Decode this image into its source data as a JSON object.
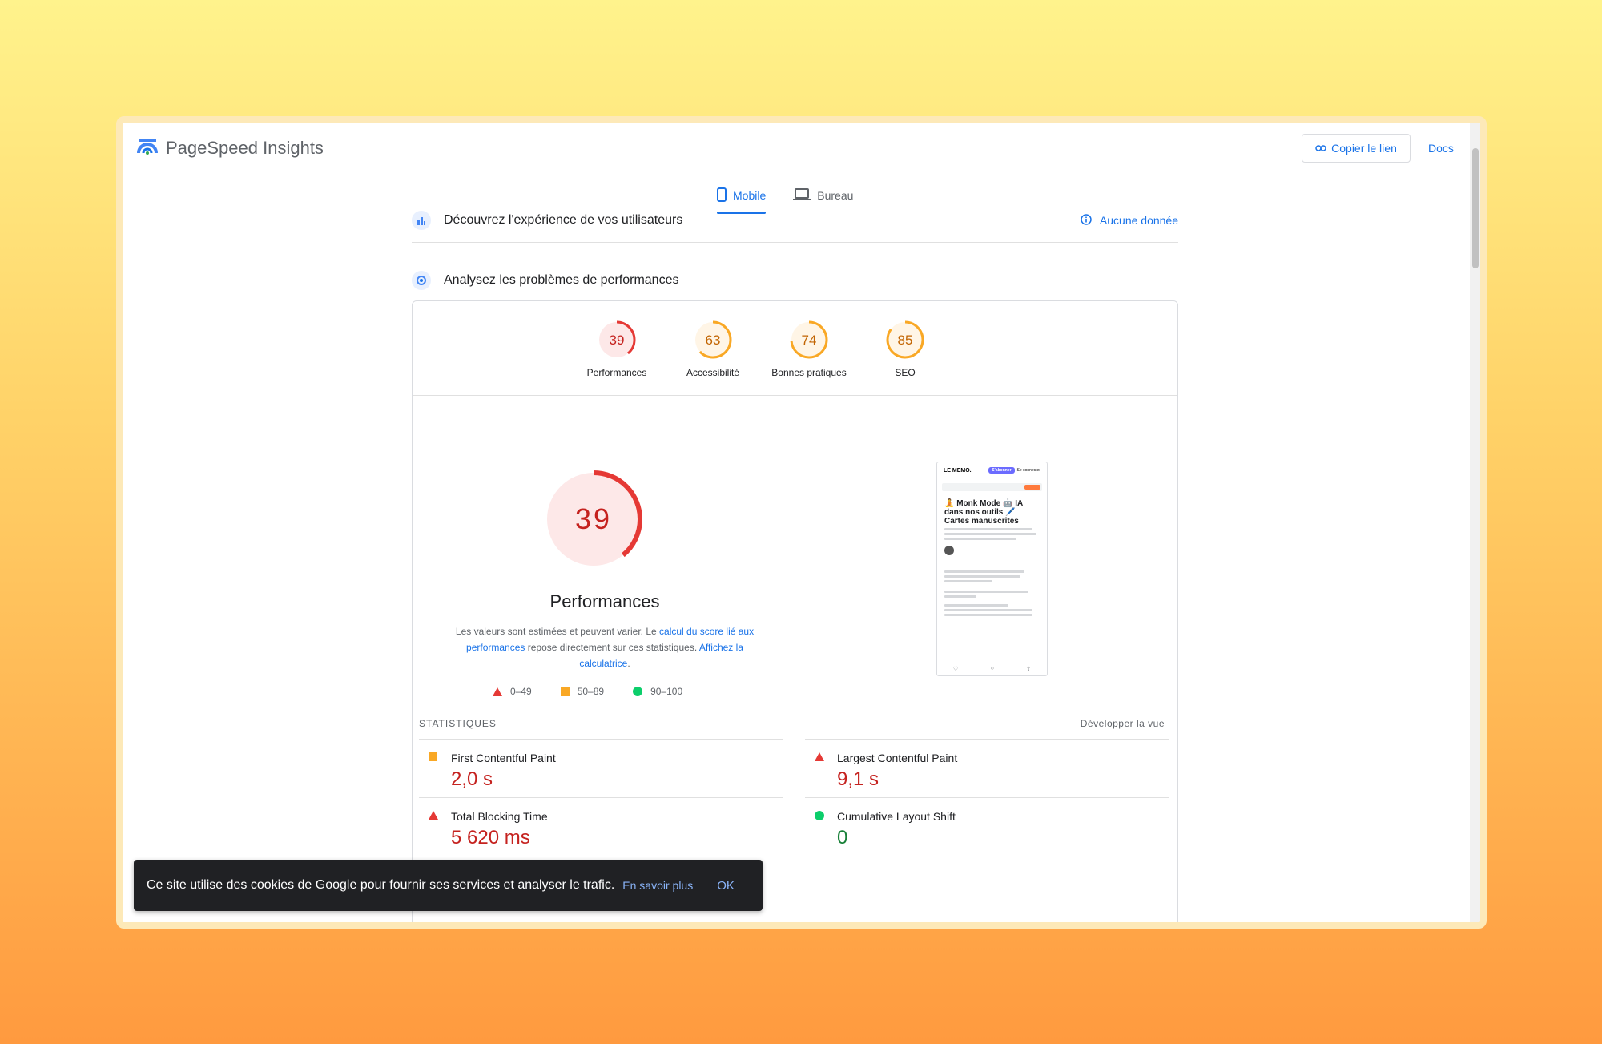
{
  "app": {
    "title": "PageSpeed Insights"
  },
  "header": {
    "copy_link_label": "Copier le lien",
    "docs_label": "Docs"
  },
  "tabs": [
    {
      "label": "Mobile",
      "active": true
    },
    {
      "label": "Bureau",
      "active": false
    }
  ],
  "field_section": {
    "title": "Découvrez l'expérience de vos utilisateurs",
    "status": "Aucune donnée"
  },
  "lab_section": {
    "title": "Analysez les problèmes de performances"
  },
  "scores": [
    {
      "label": "Performances",
      "value": 39,
      "color": "#e53935",
      "bg": "#fde8e8"
    },
    {
      "label": "Accessibilité",
      "value": 63,
      "color": "#f9a825",
      "bg": "#fff5e6"
    },
    {
      "label": "Bonnes pratiques",
      "value": 74,
      "color": "#f9a825",
      "bg": "#fff5e6"
    },
    {
      "label": "SEO",
      "value": 85,
      "color": "#f9a825",
      "bg": "#fff5e6"
    }
  ],
  "performance": {
    "score": "39",
    "title": "Performances",
    "desc_1": "Les valeurs sont estimées et peuvent varier. Le ",
    "desc_link_1": "calcul du score lié aux performances",
    "desc_2": " repose directement sur ces statistiques. ",
    "desc_link_2": "Affichez la calculatrice",
    "desc_3": "."
  },
  "legend": [
    {
      "range": "0–49",
      "shape": "triangle",
      "color": "#e53935"
    },
    {
      "range": "50–89",
      "shape": "square",
      "color": "#f9a825"
    },
    {
      "range": "90–100",
      "shape": "circle",
      "color": "#0cce6b"
    }
  ],
  "screenshot": {
    "brand": "LE MEMO.",
    "button": "S'abonner",
    "login": "Se connecter",
    "article_title": "🧘 Monk Mode 🤖 IA dans nos outils 🖊️ Cartes manuscrites"
  },
  "stats": {
    "label": "STATISTIQUES",
    "expand_label": "Développer la vue",
    "metrics": [
      {
        "name": "First Contentful Paint",
        "value": "2,0 s",
        "status": "average"
      },
      {
        "name": "Largest Contentful Paint",
        "value": "9,1 s",
        "status": "fail"
      },
      {
        "name": "Total Blocking Time",
        "value": "5 620 ms",
        "status": "fail"
      },
      {
        "name": "Cumulative Layout Shift",
        "value": "0",
        "status": "pass"
      }
    ]
  },
  "cookie_banner": {
    "text": "Ce site utilise des cookies de Google pour fournir ses services et analyser le trafic.",
    "learn_more": "En savoir plus",
    "ok": "OK"
  },
  "colors": {
    "accent": "#1a73e8",
    "fail": "#c5221f",
    "average": "#f9a825",
    "pass": "#0cce6b"
  }
}
